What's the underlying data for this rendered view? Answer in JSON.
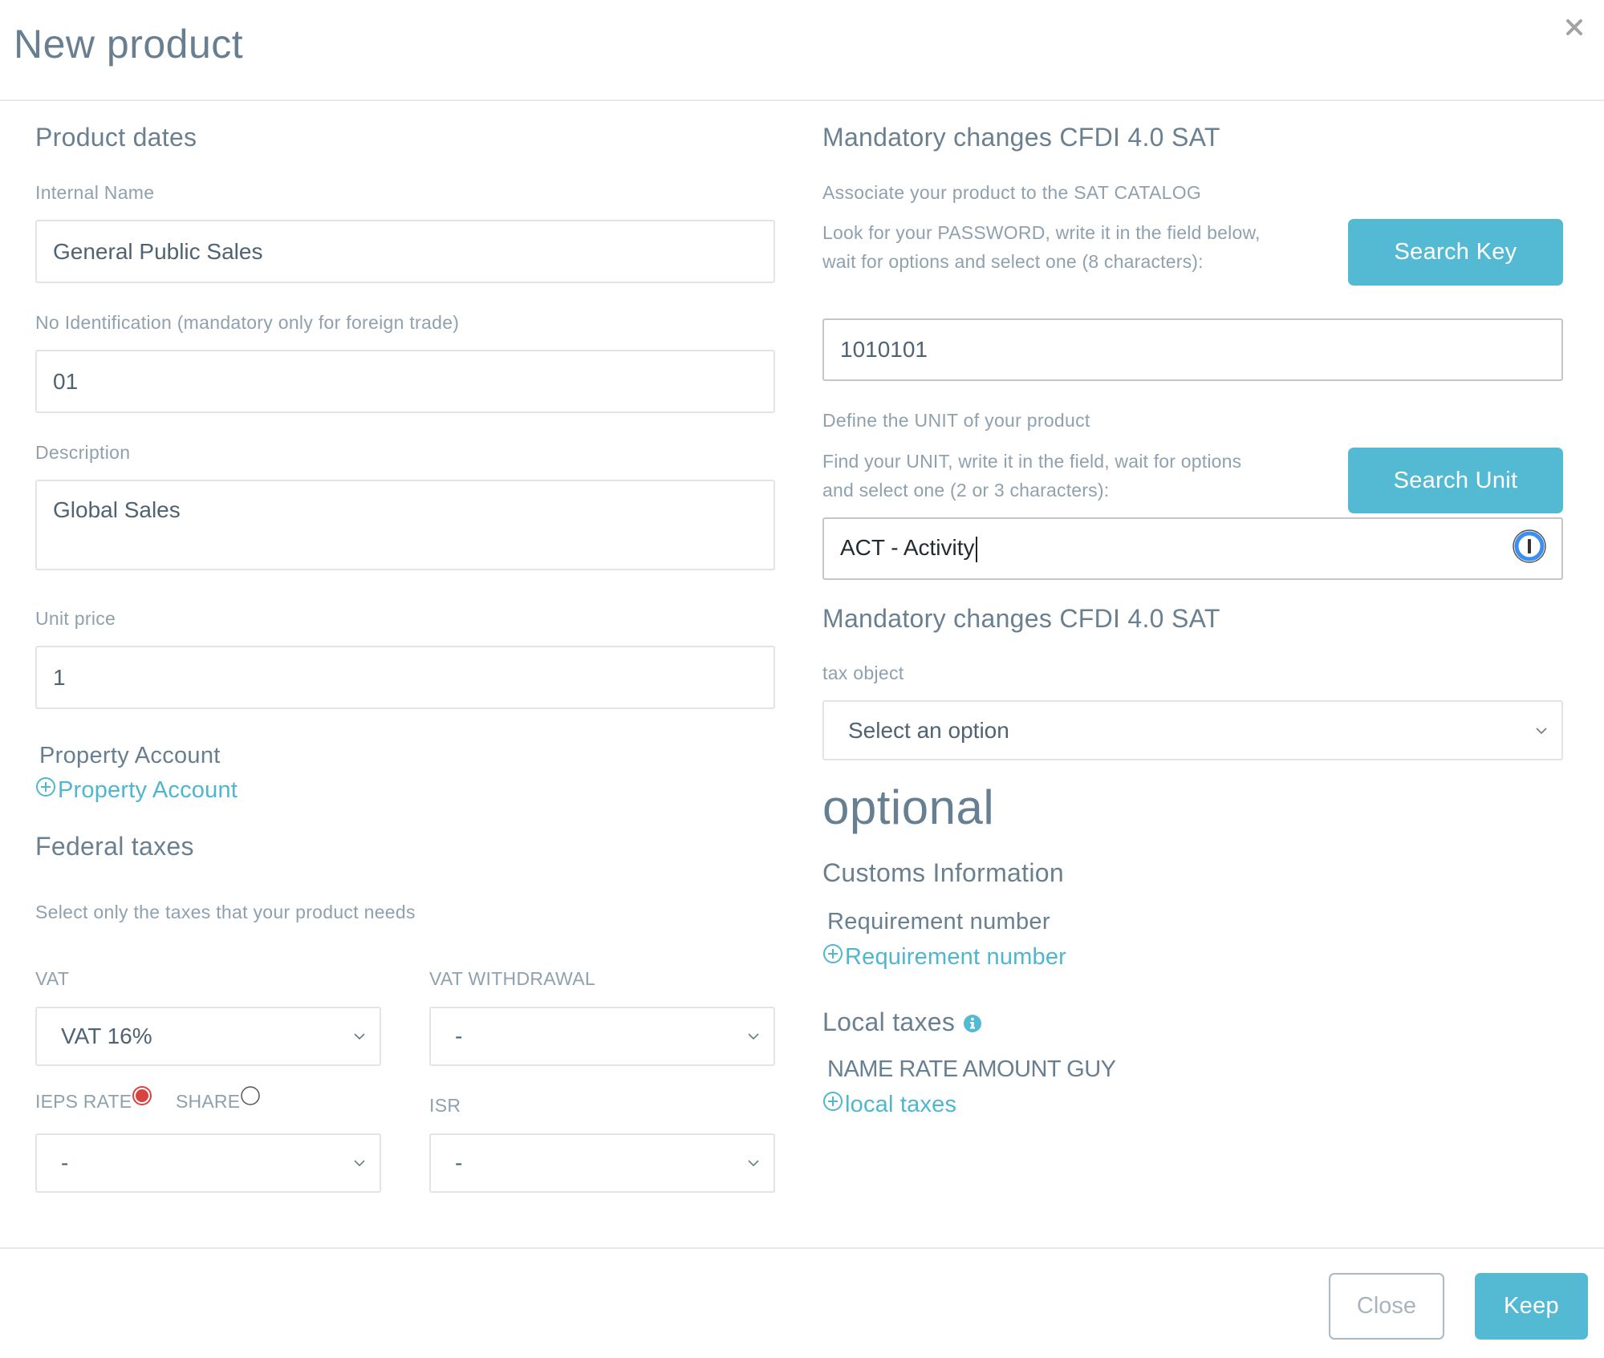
{
  "header": {
    "title": "New product",
    "close_icon": "close-icon"
  },
  "left": {
    "section_title": "Product dates",
    "internal_name": {
      "label": "Internal Name",
      "value": "General Public Sales"
    },
    "identification": {
      "label": "No Identification (mandatory only for foreign trade)",
      "value": "01"
    },
    "description": {
      "label": "Description",
      "value": "Global Sales"
    },
    "unit_price": {
      "label": "Unit price",
      "value": "1"
    },
    "property_account": {
      "label": "Property Account",
      "link": "Property Account",
      "icon": "plus-circle-icon"
    },
    "federal_taxes": {
      "title": "Federal taxes",
      "help": "Select only the taxes that your product needs",
      "vat": {
        "label": "VAT",
        "value": "VAT 16%"
      },
      "vat_withdrawal": {
        "label": "VAT WITHDRAWAL",
        "value": "-"
      },
      "ieps_rate": {
        "label": "IEPS RATE",
        "selected": true
      },
      "share": {
        "label": "SHARE",
        "selected": false
      },
      "ieps": {
        "value": "-"
      },
      "isr": {
        "label": "ISR",
        "value": "-"
      }
    }
  },
  "right": {
    "section_title": "Mandatory changes CFDI 4.0 SAT",
    "sat_catalog_label": "Associate your product to the SAT CATALOG",
    "key_help": "Look for your PASSWORD, write it in the field below, wait for options and select one (8 characters):",
    "search_key_button": "Search Key",
    "key_value": "1010101",
    "unit_label": "Define the UNIT of your product",
    "unit_help": "Find your UNIT, write it in the field, wait for options and select one (2 or 3 characters):",
    "search_unit_button": "Search Unit",
    "unit_value": "ACT - Activity",
    "section_title_2": "Mandatory changes CFDI 4.0 SAT",
    "tax_object": {
      "label": "tax object",
      "value": "Select an option"
    },
    "optional_title": "optional",
    "customs_title": "Customs Information",
    "requirement": {
      "label": "Requirement number",
      "link": "Requirement number"
    },
    "local_taxes": {
      "title": "Local taxes",
      "columns": "NAME RATE AMOUNT GUY",
      "link": "local taxes"
    }
  },
  "footer": {
    "close_button": "Close",
    "keep_button": "Keep"
  },
  "colors": {
    "accent": "#54bad3",
    "radio_selected": "#d9433f",
    "text": "#687f91"
  }
}
